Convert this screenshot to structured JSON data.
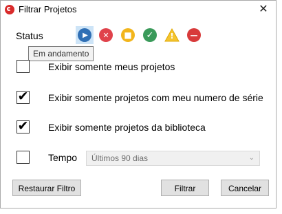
{
  "window": {
    "title": "Filtrar Projetos",
    "close_glyph": "✕"
  },
  "status": {
    "label": "Status",
    "icons": [
      {
        "name": "play-icon",
        "glyph": "▶",
        "color": "#2f6fb5",
        "selected": true
      },
      {
        "name": "cancel-x-icon",
        "glyph": "✕",
        "color": "#e0424b",
        "selected": false
      },
      {
        "name": "stop-square-icon",
        "glyph": "■",
        "color": "#f2b51c",
        "selected": false
      },
      {
        "name": "check-icon",
        "glyph": "✓",
        "color": "#3a9a5a",
        "selected": false
      },
      {
        "name": "warning-icon",
        "glyph": "!",
        "color": "#f4c430",
        "selected": false
      },
      {
        "name": "minus-icon",
        "glyph": "—",
        "color": "#d83a3a",
        "selected": false
      }
    ],
    "tooltip": "Em andamento"
  },
  "options": [
    {
      "label": "Exibir somente meus projetos",
      "checked": false
    },
    {
      "label": "Exibir somente projetos com meu numero de série",
      "checked": true
    },
    {
      "label": "Exibir somente projetos da biblioteca",
      "checked": true
    }
  ],
  "tempo": {
    "label": "Tempo",
    "checked": false,
    "selected_value": "Últimos 90 dias",
    "chevron": "⌄"
  },
  "buttons": {
    "restore": "Restaurar Filtro",
    "filter": "Filtrar",
    "cancel": "Cancelar"
  },
  "check_glyph": "✔"
}
